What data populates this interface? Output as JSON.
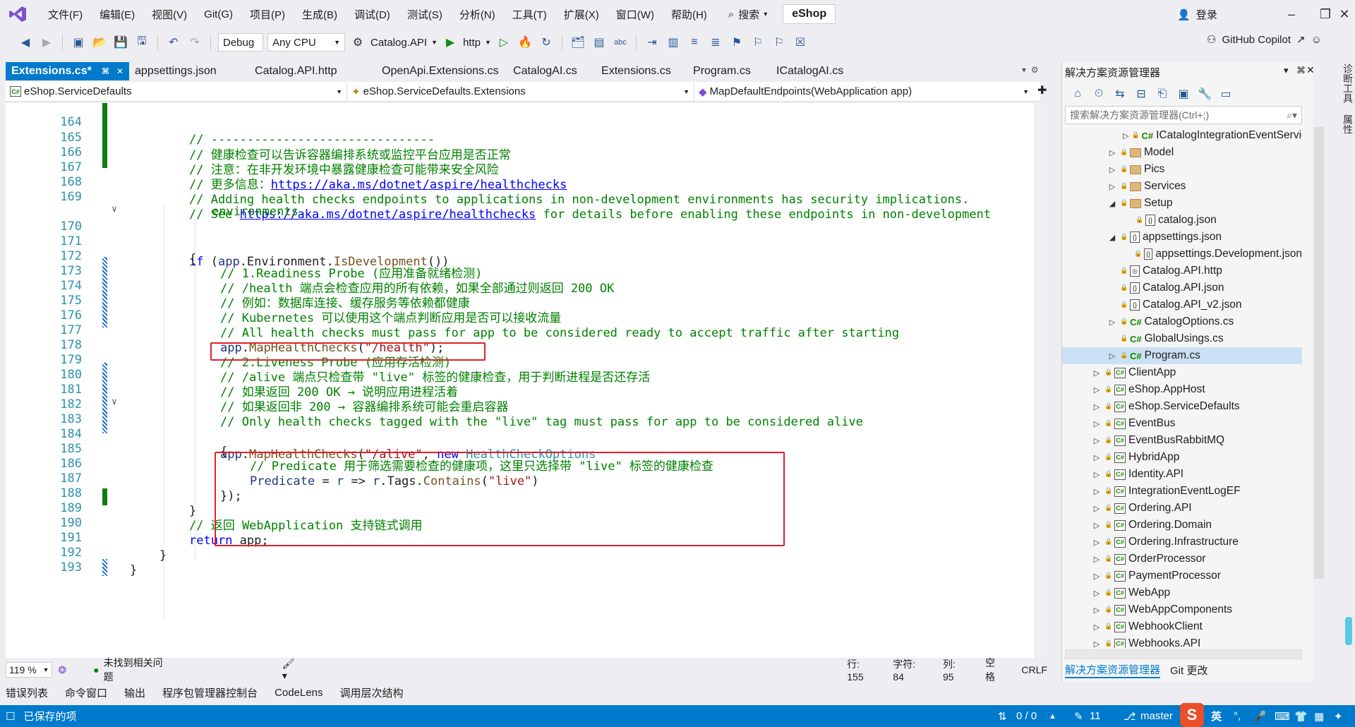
{
  "menubar": {
    "items": [
      "文件(F)",
      "编辑(E)",
      "视图(V)",
      "Git(G)",
      "项目(P)",
      "生成(B)",
      "调试(D)",
      "测试(S)",
      "分析(N)",
      "工具(T)",
      "扩展(X)",
      "窗口(W)",
      "帮助(H)"
    ],
    "search_label": "搜索",
    "solution_name": "eShop",
    "login_label": "登录"
  },
  "toolbar": {
    "config": "Debug",
    "platform": "Any CPU",
    "startup_project": "Catalog.API",
    "launch_profile": "http",
    "copilot_label": "GitHub Copilot"
  },
  "tabs": [
    {
      "label": "Extensions.cs*",
      "active": true
    },
    {
      "label": "appsettings.json",
      "active": false
    },
    {
      "label": "Catalog.API.http",
      "active": false
    },
    {
      "label": "OpenApi.Extensions.cs",
      "active": false
    },
    {
      "label": "CatalogAI.cs",
      "active": false
    },
    {
      "label": "Extensions.cs",
      "active": false
    },
    {
      "label": "Program.cs",
      "active": false
    },
    {
      "label": "ICatalogAI.cs",
      "active": false
    }
  ],
  "navbar": {
    "project": "eShop.ServiceDefaults",
    "type": "eShop.ServiceDefaults.Extensions",
    "member": "MapDefaultEndpoints(WebApplication app)"
  },
  "editor": {
    "line_numbers": [
      "164",
      "165",
      "166",
      "167",
      "168",
      "169",
      "",
      "170",
      "171",
      "172",
      "173",
      "174",
      "175",
      "176",
      "177",
      "178",
      "179",
      "180",
      "181",
      "182",
      "183",
      "184",
      "185",
      "186",
      "187",
      "188",
      "189",
      "190",
      "191",
      "192",
      "193"
    ],
    "lines": {
      "l164": "// -------------------------------",
      "l165": "// 健康检查可以告诉容器编排系统或监控平台应用是否正常",
      "l166": "// 注意：在非开发环境中暴露健康检查可能带来安全风险",
      "l167_prefix": "// 更多信息：",
      "l167_link": "https://aka.ms/dotnet/aspire/healthchecks",
      "l168": "// Adding health checks endpoints to applications in non-development environments has security implications.",
      "l169_prefix": "// See ",
      "l169_link": "https://aka.ms/dotnet/aspire/healthchecks",
      "l169_suffix": " for details before enabling these endpoints in non-development",
      "l169_wrap": "environments.",
      "l170_kw": "if",
      "l170_a": " (",
      "l170_b": "app",
      "l170_c": ".Environment.",
      "l170_d": "IsDevelopment",
      "l170_e": "())",
      "l171": "{",
      "l172": "// 1.Readiness Probe (应用准备就绪检测)",
      "l173": "// /health 端点会检查应用的所有依赖，如果全部通过则返回 200 OK",
      "l174": "// 例如：数据库连接、缓存服务等依赖都健康",
      "l175": "// Kubernetes 可以使用这个端点判断应用是否可以接收流量",
      "l176": "// All health checks must pass for app to be considered ready to accept traffic after starting",
      "l177_a": "app",
      "l177_b": ".",
      "l177_c": "MapHealthChecks",
      "l177_d": "(",
      "l177_e": "\"/health\"",
      "l177_f": ");",
      "l178": "// 2.Liveness Probe (应用存活检测)",
      "l179": "// /alive 端点只检查带 \"live\" 标签的健康检查，用于判断进程是否还存活",
      "l180": "// 如果返回 200 OK → 说明应用进程活着",
      "l181": "// 如果返回非 200 → 容器编排系统可能会重启容器",
      "l182": "// Only health checks tagged with the \"live\" tag must pass for app to be considered alive",
      "l183_a": "app",
      "l183_b": ".",
      "l183_c": "MapHealthChecks",
      "l183_d": "(",
      "l183_e": "\"/alive\"",
      "l183_f": ", ",
      "l183_g": "new",
      "l183_h": " ",
      "l183_i": "HealthCheckOptions",
      "l184": "{",
      "l185": "// Predicate 用于筛选需要检查的健康项，这里只选择带 \"live\" 标签的健康检查",
      "l186_a": "Predicate",
      "l186_b": " = ",
      "l186_c": "r",
      "l186_d": " => ",
      "l186_e": "r",
      "l186_f": ".Tags.",
      "l186_g": "Contains",
      "l186_h": "(",
      "l186_i": "\"live\"",
      "l186_j": ")",
      "l187": "});",
      "l188": "}",
      "l189": "// 返回 WebApplication 支持链式调用",
      "l190_kw": "return",
      "l190_rest": " app;",
      "l191": "}",
      "l192": "}"
    }
  },
  "editor_status": {
    "zoom": "119 %",
    "issues": "未找到相关问题",
    "line": "行: 155",
    "char": "字符: 84",
    "col": "列: 95",
    "whitespace": "空格",
    "eol": "CRLF"
  },
  "bottom_tabs": [
    "错误列表",
    "命令窗口",
    "输出",
    "程序包管理器控制台",
    "CodeLens",
    "调用层次结构"
  ],
  "statusbar": {
    "saved": "已保存的项",
    "sync": "0 / 0",
    "edits": "11",
    "branch": "master",
    "ime": "英"
  },
  "solution_explorer": {
    "title": "解决方案资源管理器",
    "search_placeholder": "搜索解决方案资源管理器(Ctrl+;)",
    "items": [
      {
        "label": "ICatalogIntegrationEventServic",
        "kind": "cs",
        "indent": 3,
        "exp": "right"
      },
      {
        "label": "Model",
        "kind": "folder",
        "indent": 2,
        "exp": "right"
      },
      {
        "label": "Pics",
        "kind": "folder",
        "indent": 2,
        "exp": "right"
      },
      {
        "label": "Services",
        "kind": "folder",
        "indent": 2,
        "exp": "right"
      },
      {
        "label": "Setup",
        "kind": "folder",
        "indent": 2,
        "exp": "down"
      },
      {
        "label": "catalog.json",
        "kind": "json",
        "indent": 3,
        "exp": "none"
      },
      {
        "label": "appsettings.json",
        "kind": "json",
        "indent": 2,
        "exp": "down"
      },
      {
        "label": "appsettings.Development.json",
        "kind": "json",
        "indent": 3,
        "exp": "none"
      },
      {
        "label": "Catalog.API.http",
        "kind": "http",
        "indent": 2,
        "exp": "none"
      },
      {
        "label": "Catalog.API.json",
        "kind": "json",
        "indent": 2,
        "exp": "none"
      },
      {
        "label": "Catalog.API_v2.json",
        "kind": "json",
        "indent": 2,
        "exp": "none"
      },
      {
        "label": "CatalogOptions.cs",
        "kind": "cs",
        "indent": 2,
        "exp": "right"
      },
      {
        "label": "GlobalUsings.cs",
        "kind": "cs",
        "indent": 2,
        "exp": "none"
      },
      {
        "label": "Program.cs",
        "kind": "cs",
        "indent": 2,
        "exp": "right",
        "selected": true
      },
      {
        "label": "ClientApp",
        "kind": "proj",
        "indent": 1,
        "exp": "right"
      },
      {
        "label": "eShop.AppHost",
        "kind": "proj",
        "indent": 1,
        "exp": "right"
      },
      {
        "label": "eShop.ServiceDefaults",
        "kind": "proj",
        "indent": 1,
        "exp": "right"
      },
      {
        "label": "EventBus",
        "kind": "proj",
        "indent": 1,
        "exp": "right"
      },
      {
        "label": "EventBusRabbitMQ",
        "kind": "proj",
        "indent": 1,
        "exp": "right"
      },
      {
        "label": "HybridApp",
        "kind": "proj",
        "indent": 1,
        "exp": "right"
      },
      {
        "label": "Identity.API",
        "kind": "proj",
        "indent": 1,
        "exp": "right"
      },
      {
        "label": "IntegrationEventLogEF",
        "kind": "proj",
        "indent": 1,
        "exp": "right"
      },
      {
        "label": "Ordering.API",
        "kind": "proj",
        "indent": 1,
        "exp": "right"
      },
      {
        "label": "Ordering.Domain",
        "kind": "proj",
        "indent": 1,
        "exp": "right"
      },
      {
        "label": "Ordering.Infrastructure",
        "kind": "proj",
        "indent": 1,
        "exp": "right"
      },
      {
        "label": "OrderProcessor",
        "kind": "proj",
        "indent": 1,
        "exp": "right"
      },
      {
        "label": "PaymentProcessor",
        "kind": "proj",
        "indent": 1,
        "exp": "right"
      },
      {
        "label": "WebApp",
        "kind": "proj",
        "indent": 1,
        "exp": "right"
      },
      {
        "label": "WebAppComponents",
        "kind": "proj",
        "indent": 1,
        "exp": "right"
      },
      {
        "label": "WebhookClient",
        "kind": "proj",
        "indent": 1,
        "exp": "right"
      },
      {
        "label": "Webhooks.API",
        "kind": "proj",
        "indent": 1,
        "exp": "right"
      }
    ],
    "bottom_tabs": [
      "解决方案资源管理器",
      "Git 更改"
    ]
  },
  "right_strip": {
    "label1": "诊断工具",
    "label2": "属性"
  }
}
